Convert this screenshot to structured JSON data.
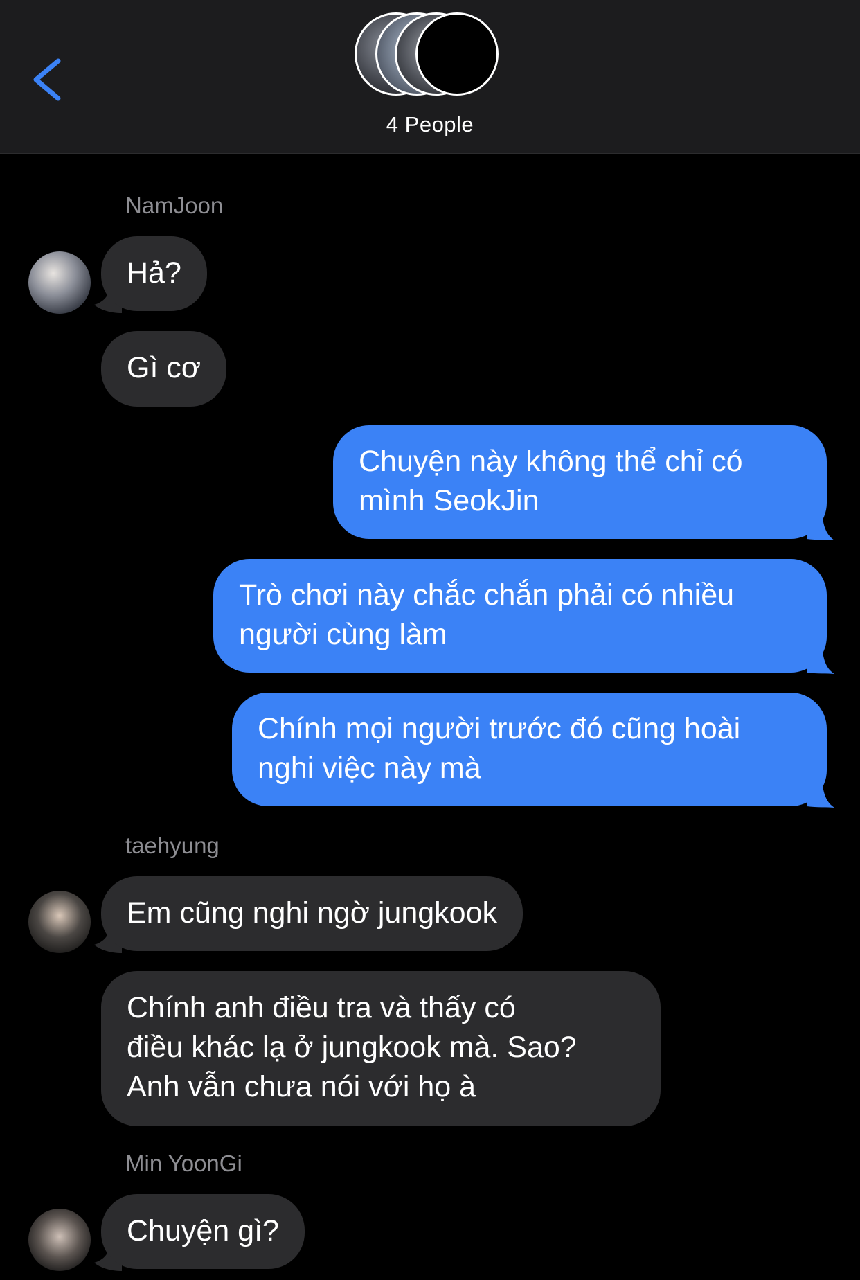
{
  "header": {
    "back_icon": "chevron-left-icon",
    "group_title": "4 People",
    "accent_color": "#3b82f6"
  },
  "messages": [
    {
      "sender": "NamJoon",
      "text": "Hả?"
    },
    {
      "text": "Gì cơ"
    },
    {
      "text": "Chuyện này không thể chỉ có\nmình SeokJin"
    },
    {
      "text": "Trò chơi này chắc chắn phải có nhiều\nngười cùng làm"
    },
    {
      "text": "Chính mọi người trước đó cũng hoài\nnghi việc này mà"
    },
    {
      "sender": "taehyung",
      "text": "Em cũng nghi ngờ jungkook"
    },
    {
      "text": "Chính anh điều tra và thấy có\nđiều khác lạ ở jungkook mà. Sao?\nAnh vẫn chưa nói với họ à"
    },
    {
      "sender": "Min YoonGi",
      "text": "Chuyện gì?"
    }
  ],
  "colors": {
    "incoming_bubble": "#2c2c2e",
    "outgoing_bubble": "#3b82f6",
    "sender_label": "#8e8e93"
  }
}
